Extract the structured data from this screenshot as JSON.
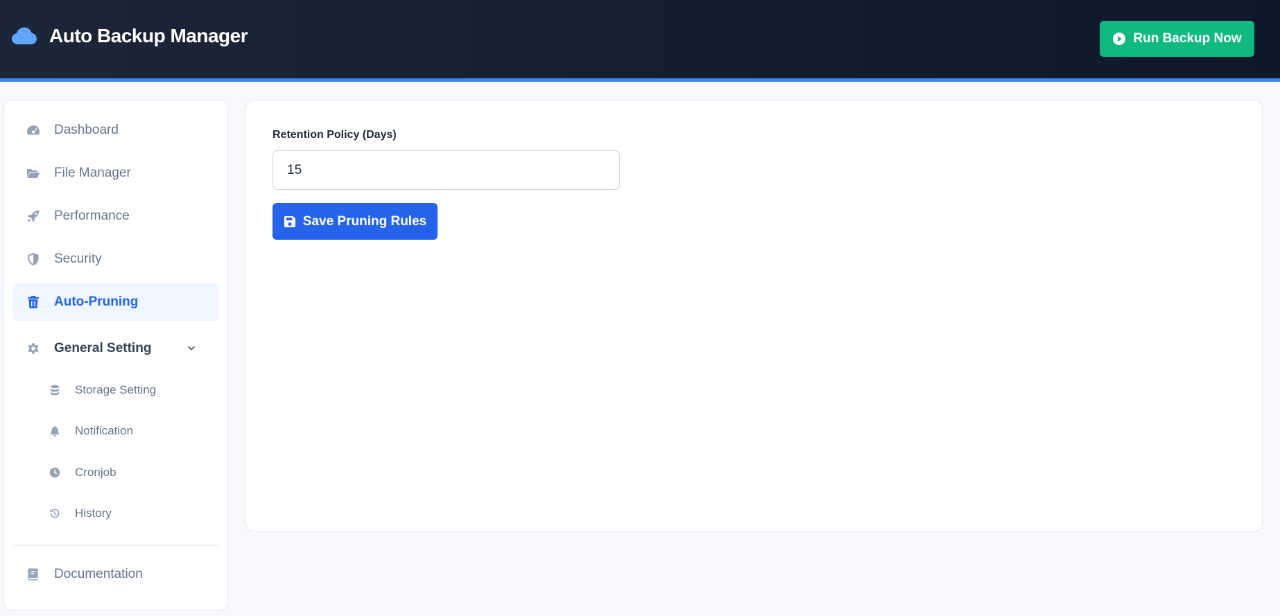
{
  "header": {
    "title": "Auto Backup Manager",
    "run_label": "Run Backup Now",
    "brand_icon": "cloud-icon"
  },
  "sidebar": {
    "items": [
      {
        "label": "Dashboard",
        "icon": "dashboard-icon"
      },
      {
        "label": "File Manager",
        "icon": "folder-icon"
      },
      {
        "label": "Performance",
        "icon": "rocket-icon"
      },
      {
        "label": "Security",
        "icon": "shield-icon"
      },
      {
        "label": "Auto-Pruning",
        "icon": "trash-icon",
        "active": true
      }
    ],
    "general": {
      "label": "General Setting",
      "icon": "gear-icon",
      "expanded": true,
      "children": [
        {
          "label": "Storage Setting",
          "icon": "database-icon"
        },
        {
          "label": "Notification",
          "icon": "bell-icon"
        },
        {
          "label": "Cronjob",
          "icon": "clock-icon"
        },
        {
          "label": "History",
          "icon": "history-icon"
        }
      ]
    },
    "documentation": {
      "label": "Documentation",
      "icon": "book-icon"
    }
  },
  "main": {
    "retention_label": "Retention Policy (Days)",
    "retention_value": "15",
    "save_label": "Save Pruning Rules"
  },
  "colors": {
    "accent": "#2563eb",
    "success": "#10b981",
    "header_bg": "#0f172a",
    "active_bg": "#eff6ff"
  }
}
